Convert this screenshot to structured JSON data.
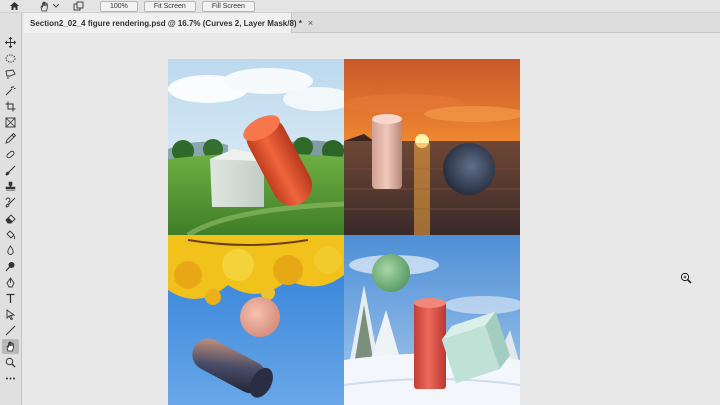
{
  "options_bar": {
    "zoom_100_label": "100%",
    "fit_screen_label": "Fit Screen",
    "fill_screen_label": "Fill Screen"
  },
  "document_tab": {
    "title": "Section2_02_4 figure rendering.psd @ 16.7% (Curves 2, Layer Mask/8) *",
    "close_glyph": "×"
  },
  "toolbar": {
    "tools": [
      "move-tool",
      "marquee-tool",
      "lasso-tool",
      "magic-wand-tool",
      "crop-tool",
      "frame-tool",
      "eyedropper-tool",
      "healing-brush-tool",
      "brush-tool",
      "clone-stamp-tool",
      "history-brush-tool",
      "eraser-tool",
      "paint-bucket-tool",
      "blur-tool",
      "dodge-tool",
      "pen-tool",
      "type-tool",
      "path-selection-tool",
      "line-tool",
      "hand-tool",
      "zoom-tool",
      "more-tools"
    ],
    "active_tool": "hand-tool"
  },
  "colors": {
    "ui_background": "#e8e8e8",
    "toolbar_background": "#e0e0e0",
    "active_tool": "#b9b9b9"
  }
}
